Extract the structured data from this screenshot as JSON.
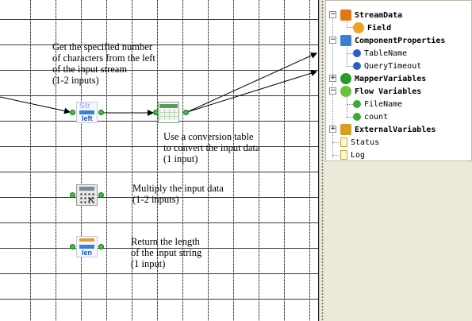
{
  "canvas": {
    "nodes": [
      {
        "id": "left",
        "icon": "str-left-icon",
        "icon_text_top": "Str",
        "icon_text": "left",
        "description": [
          "Get the specified number",
          "of characters from the left",
          "of the input stream",
          "(1-2 inputs)"
        ]
      },
      {
        "id": "table",
        "icon": "conversion-table-icon",
        "description": [
          "Use a conversion table",
          "to convert the input data",
          "(1 input)"
        ]
      },
      {
        "id": "multiply",
        "icon": "calculator-icon",
        "description": [
          "Multiply the input data",
          "(1-2 inputs)"
        ]
      },
      {
        "id": "len",
        "icon": "str-len-icon",
        "icon_text": "len",
        "description": [
          "Return the length",
          "of the input string",
          "(1 input)"
        ]
      }
    ]
  },
  "tree": {
    "items": [
      {
        "label": "StreamData",
        "bold": true,
        "icon": "stream-data-icon",
        "icon_color": "#e07818",
        "expander": "minus"
      },
      {
        "label": "Field",
        "bold": true,
        "icon": "field-icon",
        "icon_color": "#f0a020"
      },
      {
        "label": "ComponentProperties",
        "bold": true,
        "icon": "puzzle-icon",
        "icon_color": "#3a7fd0",
        "expander": "minus"
      },
      {
        "label": "TableName",
        "bold": false,
        "icon": "property-icon",
        "icon_color": "#2a5fd0"
      },
      {
        "label": "QueryTimeout",
        "bold": false,
        "icon": "property-icon",
        "icon_color": "#2a5fd0"
      },
      {
        "label": "MapperVariables",
        "bold": true,
        "icon": "mapper-variables-icon",
        "icon_color": "#2a9a2a",
        "expander": "plus"
      },
      {
        "label": "Flow Variables",
        "bold": true,
        "icon": "flow-variables-icon",
        "icon_color": "#6ac23a",
        "expander": "minus"
      },
      {
        "label": "FileName",
        "bold": false,
        "icon": "variable-icon",
        "icon_color": "#3aaa3a"
      },
      {
        "label": "count",
        "bold": false,
        "icon": "variable-icon",
        "icon_color": "#3aaa3a"
      },
      {
        "label": "ExternalVariables",
        "bold": true,
        "icon": "external-variables-icon",
        "icon_color": "#d4a020",
        "expander": "plus"
      },
      {
        "label": "Status",
        "bold": false,
        "icon": "document-icon",
        "icon_color": "#e0c060"
      },
      {
        "label": "Log",
        "bold": false,
        "icon": "document-icon",
        "icon_color": "#e0c060"
      }
    ]
  }
}
